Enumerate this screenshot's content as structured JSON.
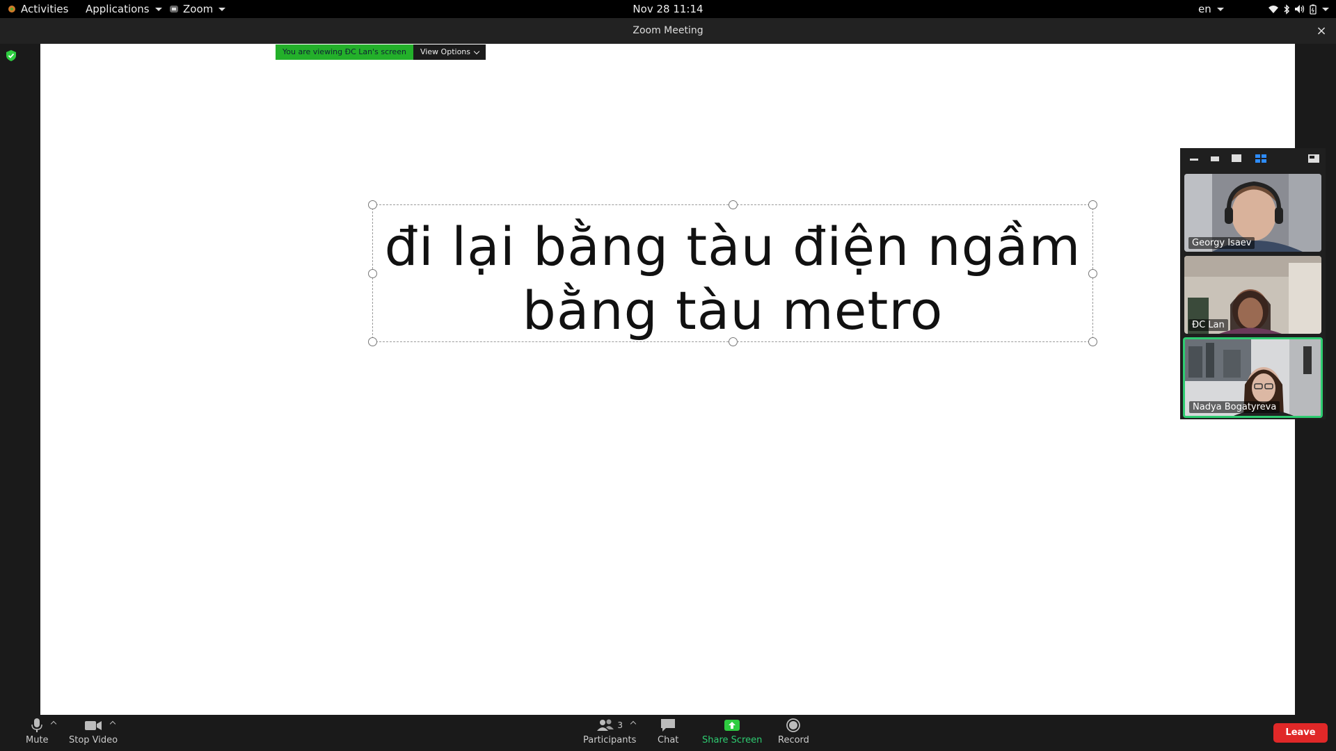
{
  "topbar": {
    "activities": "Activities",
    "applications": "Applications",
    "app": "Zoom",
    "clock": "Nov 28  11:14",
    "lang": "en"
  },
  "window": {
    "title": "Zoom Meeting",
    "close": "×"
  },
  "share_banner": {
    "viewing": "You are viewing ĐC Lan's screen",
    "view_options": "View Options"
  },
  "slide": {
    "line1": "đi lại bằng tàu điện ngầm",
    "line2": "bằng tàu metro"
  },
  "participants_panel": [
    {
      "name": "Georgy Isaev"
    },
    {
      "name": "ĐC Lan"
    },
    {
      "name": "Nadya Bogatyreva"
    }
  ],
  "toolbar": {
    "mute": "Mute",
    "stop_video": "Stop Video",
    "participants": "Participants",
    "participants_count": "3",
    "chat": "Chat",
    "share_screen": "Share Screen",
    "record": "Record",
    "leave": "Leave"
  },
  "colors": {
    "banner_green": "#23b02a",
    "active_border": "#2ecc71",
    "leave_red": "#e02828"
  }
}
